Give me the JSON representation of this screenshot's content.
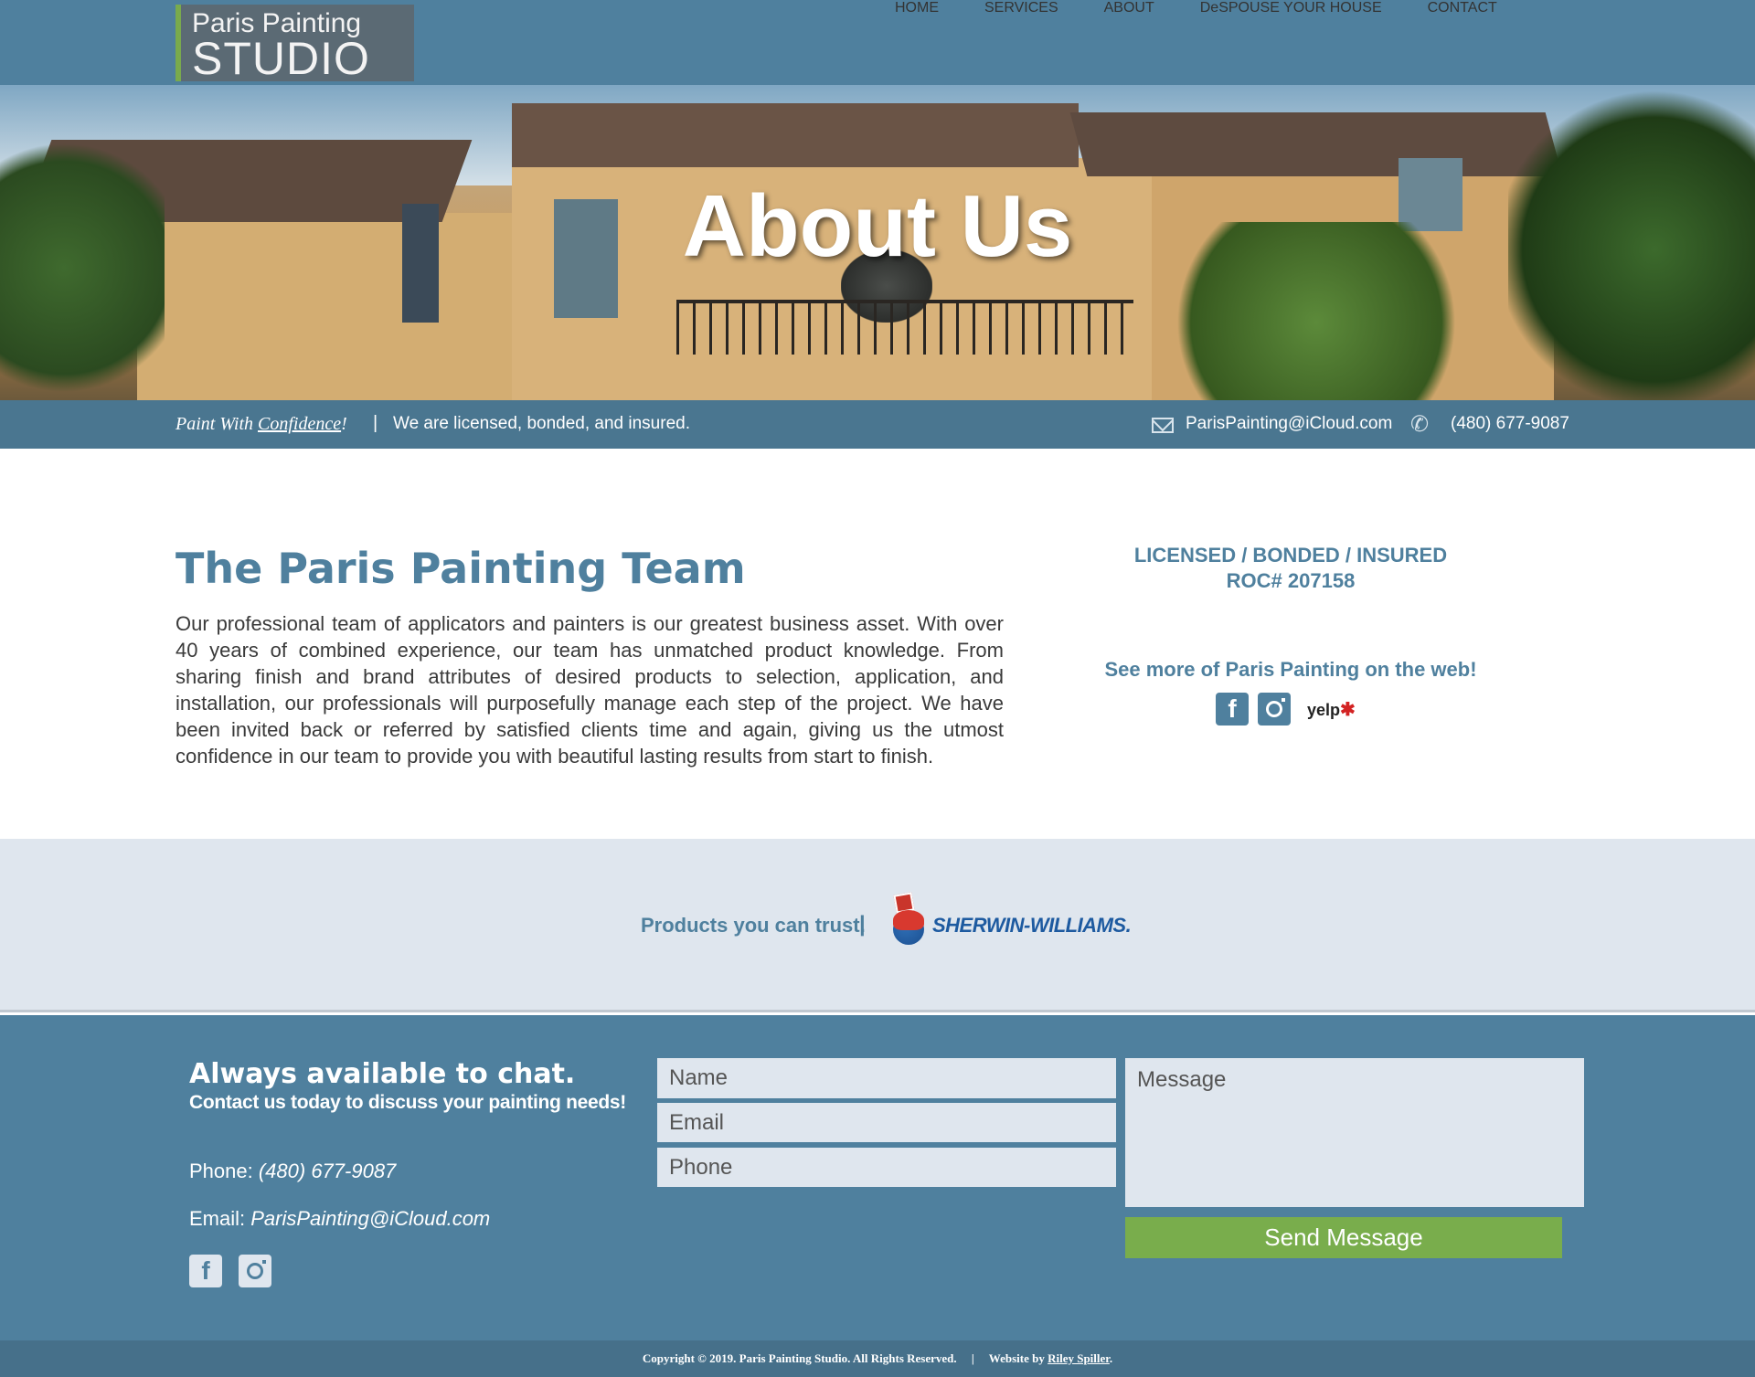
{
  "logo": {
    "line1": "Paris Painting",
    "line2": "STUDIO"
  },
  "nav": {
    "items": [
      {
        "label": "HOME"
      },
      {
        "label": "SERVICES"
      },
      {
        "label": "ABOUT",
        "active": true
      },
      {
        "label": "DeSPOUSE YOUR HOUSE"
      },
      {
        "label": "CONTACT"
      }
    ]
  },
  "hero": {
    "title": "About Us"
  },
  "infobar": {
    "tagline_prefix": "Paint With ",
    "tagline_word": "Confidence",
    "tagline_suffix": "!",
    "separator": "|",
    "licensed": "We are licensed, bonded, and insured.",
    "email": "ParisPainting@iCloud.com",
    "phone": "(480) 677-9087"
  },
  "main": {
    "title": "The Paris Painting Team",
    "body": "Our professional team of applicators and painters is our greatest business asset. With over 40 years of combined experience, our team has unmatched product knowledge. From sharing finish and brand attributes of desired products to selection, application, and installation, our professionals will purposefully manage each step of the project. We have been invited back or referred by satisfied clients time and again, giving us the utmost confidence in our team to provide you with beautiful lasting results from start to finish."
  },
  "sidebar": {
    "license_line1": "LICENSED / BONDED / INSURED",
    "license_line2": "ROC# 207158",
    "see_more": "See more of Paris Painting on the web!",
    "facebook_glyph": "f",
    "yelp_label": "yelp",
    "yelp_burst": "✱"
  },
  "products": {
    "text": "Products you can trust.",
    "separator": "|",
    "brand": "SHERWIN-WILLIAMS."
  },
  "footer": {
    "heading": "Always available to chat.",
    "subheading": "Contact us today to discuss your painting needs!",
    "phone_label": "Phone: ",
    "phone_value": "(480) 677-9087",
    "email_label": "Email: ",
    "email_value": "ParisPainting@iCloud.com",
    "facebook_glyph": "f",
    "form": {
      "name_placeholder": "Name",
      "email_placeholder": "Email",
      "phone_placeholder": "Phone",
      "message_placeholder": "Message",
      "send_label": "Send Message"
    }
  },
  "copyright": {
    "text": "Copyright © 2019. Paris Painting Studio. All Rights Reserved.",
    "separator": "|",
    "credit_prefix": "Website by ",
    "credit_name": "Riley Spiller",
    "credit_suffix": "."
  },
  "colors": {
    "primary": "#4f809e",
    "accent_green": "#79ad4c",
    "light_band": "#dfe6ee"
  }
}
